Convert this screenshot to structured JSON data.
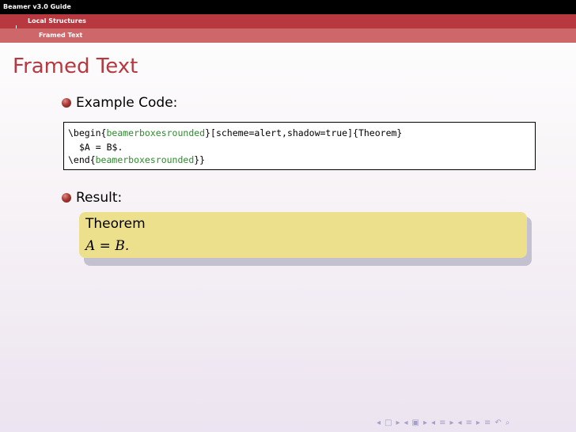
{
  "header": {
    "document_title": "Beamer v3.0 Guide",
    "section": "Local Structures",
    "subsection": "Framed Text"
  },
  "frame": {
    "title": "Framed Text"
  },
  "items": [
    {
      "label": "Example Code:"
    },
    {
      "label": "Result:"
    }
  ],
  "code": {
    "line1_pre": "\\begin{",
    "line1_kw": "beamerboxesrounded",
    "line1_post": "}[scheme=alert,shadow=true]{Theorem}",
    "line2": "$A = B$.",
    "line3_pre": "\\end{",
    "line3_kw": "beamerboxesrounded",
    "line3_post": "}}"
  },
  "result_box": {
    "title": "Theorem",
    "body": "A = B."
  },
  "colors": {
    "header_top": "#000000",
    "header_section": "#b7383f",
    "header_subsection": "#cd6769",
    "frame_title": "#b7383f",
    "code_keyword": "#2e8b2e",
    "block_background": "#ede08c",
    "navigation": "#a5a0c6"
  },
  "navigation": {
    "icons": [
      "prev-slide-icon",
      "slide-icon",
      "next-slide-icon",
      "prev-frame-icon",
      "frame-icon",
      "next-frame-icon",
      "prev-section-icon",
      "section-icon",
      "next-section-icon",
      "prev-subsection-icon",
      "subsection-icon",
      "next-subsection-icon",
      "outline-align-icon",
      "back-icon",
      "search-icon"
    ]
  }
}
